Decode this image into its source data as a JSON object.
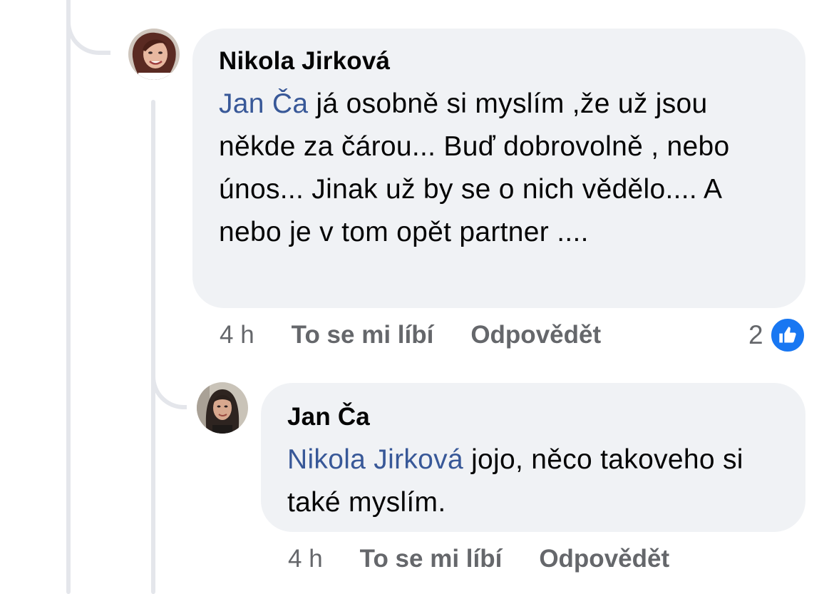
{
  "comments": [
    {
      "author": "Nikola Jirková",
      "mention": "Jan Ča",
      "text": " já osobně si myslím ,že už jsou někde za čárou... Buď dobrovolně , nebo únos... Jinak  už by se o nich vědělo.... A nebo je v tom opět partner ....",
      "time": "4 h",
      "like_label": "To se mi líbí",
      "reply_label": "Odpovědět",
      "reactions_count": "2",
      "reaction_icon": "thumbs-up-icon"
    },
    {
      "author": "Jan Ča",
      "mention": "Nikola Jirková",
      "text": " jojo, něco takoveho si také myslím.",
      "time": "4 h",
      "like_label": "To se mi líbí",
      "reply_label": "Odpovědět"
    }
  ],
  "colors": {
    "bubble": "#f0f2f5",
    "mention": "#385898",
    "meta": "#65676b",
    "like_badge": "#1877f2",
    "thread_line": "#e4e6eb"
  }
}
